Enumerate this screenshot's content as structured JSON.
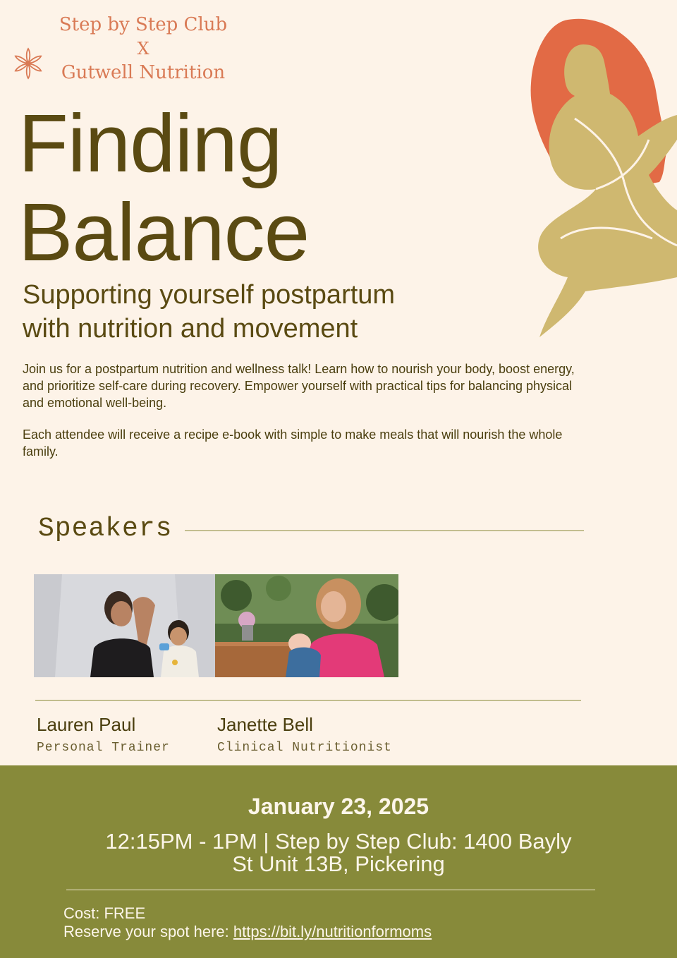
{
  "brand": {
    "line1": "Step by Step Club",
    "line2": "X",
    "line3": "Gutwell Nutrition",
    "color": "#d97a55"
  },
  "title": {
    "line1": "Finding",
    "line2": "Balance"
  },
  "subtitle": {
    "line1": "Supporting yourself postpartum",
    "line2": "with nutrition and movement"
  },
  "body": {
    "p1": "Join us for a postpartum nutrition and wellness talk! Learn how to nourish your body, boost energy, and prioritize self-care during recovery. Empower yourself with practical tips for balancing physical and emotional well-being.",
    "p2": "Each attendee will receive a recipe e-book with simple to make meals that will nourish the whole family."
  },
  "speakers": {
    "heading": "Speakers",
    "items": [
      {
        "name": "Lauren Paul",
        "role": "Personal Trainer"
      },
      {
        "name": "Janette Bell",
        "role": "Clinical Nutritionist"
      }
    ]
  },
  "event": {
    "date": "January 23, 2025",
    "time_location": "12:15PM - 1PM | Step by Step Club: 1400 Bayly St Unit 13B, Pickering",
    "cost": "Cost: FREE",
    "reserve_label": "Reserve your spot here: ",
    "reserve_link": "https://bit.ly/nutritionformoms"
  },
  "colors": {
    "background": "#fdf3e8",
    "text": "#5a4a12",
    "footer": "#878a3a",
    "figure_body": "#cfb870",
    "figure_hair": "#e26a45"
  }
}
